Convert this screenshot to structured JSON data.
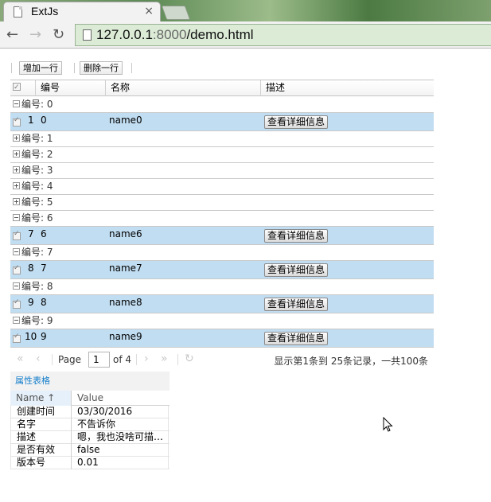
{
  "browser": {
    "tab_title": "ExtJs",
    "tab_close": "×",
    "url_host": "127.0.0.1",
    "url_port": ":8000",
    "url_path": "/demo.html",
    "back": "←",
    "forward": "→",
    "reload": "↻"
  },
  "toolbar": {
    "add_label": "增加一行",
    "delete_label": "删除一行"
  },
  "grid": {
    "columns": [
      "编号",
      "名称",
      "描述"
    ],
    "groups": [
      {
        "label": "编号: 0",
        "expanded": true,
        "row": {
          "num": "1",
          "id": "0",
          "name": "name0",
          "button": "查看详细信息"
        }
      },
      {
        "label": "编号: 1",
        "expanded": false
      },
      {
        "label": "编号: 2",
        "expanded": false
      },
      {
        "label": "编号: 3",
        "expanded": false
      },
      {
        "label": "编号: 4",
        "expanded": false
      },
      {
        "label": "编号: 5",
        "expanded": false
      },
      {
        "label": "编号: 6",
        "expanded": true,
        "row": {
          "num": "7",
          "id": "6",
          "name": "name6",
          "button": "查看详细信息"
        }
      },
      {
        "label": "编号: 7",
        "expanded": true,
        "row": {
          "num": "8",
          "id": "7",
          "name": "name7",
          "button": "查看详细信息"
        }
      },
      {
        "label": "编号: 8",
        "expanded": true,
        "row": {
          "num": "9",
          "id": "8",
          "name": "name8",
          "button": "查看详细信息"
        }
      },
      {
        "label": "编号: 9",
        "expanded": true,
        "row": {
          "num": "10",
          "id": "9",
          "name": "name9",
          "button": "查看详细信息"
        }
      }
    ]
  },
  "pager": {
    "page_label": "Page",
    "page_value": "1",
    "of_label": "of 4",
    "summary": "显示第1条到 25条记录，一共100条"
  },
  "property_grid": {
    "title": "属性表格",
    "col_name": "Name ↑",
    "col_value": "Value",
    "rows": [
      {
        "name": "创建时间",
        "value": "03/30/2016"
      },
      {
        "name": "名字",
        "value": "不告诉你"
      },
      {
        "name": "描述",
        "value": "嗯，我也没啥可描…"
      },
      {
        "name": "是否有效",
        "value": "false"
      },
      {
        "name": "版本号",
        "value": "0.01"
      }
    ]
  }
}
